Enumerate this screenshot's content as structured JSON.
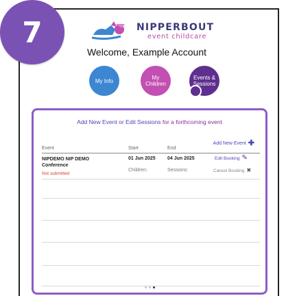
{
  "step": {
    "number": "7"
  },
  "brand": {
    "name": "NIPPERBOUT",
    "tagline": "event childcare"
  },
  "welcome_text": "Welcome, Example Account",
  "nav": [
    {
      "label_lines": [
        "My Info"
      ],
      "color": "#3d86d2"
    },
    {
      "label_lines": [
        "My",
        "Children"
      ],
      "color": "#c24fb2"
    },
    {
      "label_lines": [
        "Events &",
        "Sessions"
      ],
      "color": "#5e2f8e",
      "selected": true
    }
  ],
  "panel": {
    "heading": {
      "part1": "Add New Event",
      "part2": " or ",
      "part3": "Edit Sessions",
      "part4": " for a forthcoming event"
    },
    "add_event_label": "Add New Event",
    "columns": {
      "event": "Event",
      "start": "Start",
      "end": "End"
    },
    "events": [
      {
        "name_line1": "NIPDEMO NIP DEMO",
        "name_line2": "Conference",
        "status": "Not submitted",
        "start": "01 Jun 2025",
        "end": "04 Jun 2025",
        "children_label": "Children:",
        "sessions_label": "Sessions:",
        "edit_label": "Edit Booking",
        "cancel_label": "Cancel Booking"
      }
    ],
    "pager": {
      "total": 3,
      "active_index": 2
    }
  },
  "colors": {
    "accent_purple": "#8b5cc7",
    "link_blue": "#4a45b8",
    "status_red": "#d23a2e"
  }
}
